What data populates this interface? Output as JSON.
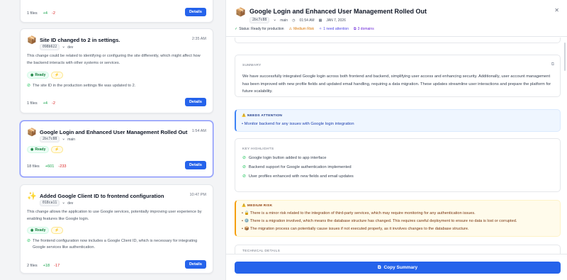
{
  "feed": {
    "cards": [
      {
        "id": "card0",
        "files": "1 files",
        "added": "+4",
        "removed": "-2",
        "details_label": "Details"
      },
      {
        "id": "card1",
        "emoji": "📦",
        "title": "Site ID changed to 2 in settings.",
        "time": "2:35 AM",
        "hash": "098b622",
        "author": "dev",
        "description": "This change could be related to identifying or configuring the site differently, which might affect how the backend interacts with other systems or services.",
        "status": "Ready",
        "risk_icon": "⚡",
        "checks": [
          "The site ID in the production settings file was updated to 2."
        ],
        "files": "1 files",
        "added": "+4",
        "removed": "-2",
        "details_label": "Details"
      },
      {
        "id": "card2",
        "emoji": "📦",
        "title": "Google Login and Enhanced User Management Rolled Out",
        "time": "1:54 AM",
        "hash": "2bc7c88",
        "author": "main",
        "status": "Ready",
        "risk_icon": "⚡",
        "files": "18 files",
        "added": "+601",
        "removed": "-233",
        "details_label": "Details"
      },
      {
        "id": "card3",
        "emoji": "✨",
        "title": "Added Google Client ID to frontend configuration",
        "time": "10:47 PM",
        "hash": "018ca11",
        "author": "dev",
        "description": "This change allows the application to use Google services, potentially improving user experience by enabling features like Google login.",
        "status": "Ready",
        "risk_icon": "⚡",
        "checks": [
          "The frontend configuration now includes a Google Client ID, which is necessary for integrating Google services like authentication."
        ],
        "files": "2 files",
        "added": "+18",
        "removed": "-17",
        "details_label": "Details"
      }
    ]
  },
  "panel": {
    "emoji": "📦",
    "title": "Google Login and Enhanced User Management Rolled Out",
    "hash": "2bc7c88",
    "branch": "main",
    "time": "01:54 AM",
    "date": "JAN 7, 2026",
    "status_chips": [
      {
        "icon": "✓",
        "text": "Status: Ready for production",
        "color": "#374151",
        "icon_color": "#16a34a"
      },
      {
        "icon": "⚠",
        "text": "Medium Risk",
        "color": "#d97706",
        "icon_color": "#d97706"
      },
      {
        "icon": "✧",
        "text": "1 need attention",
        "color": "#4f46e5",
        "icon_color": "#4f46e5"
      },
      {
        "icon": "⧉",
        "text": "3 domains",
        "color": "#6d28d9",
        "icon_color": "#6d28d9"
      }
    ],
    "summary": {
      "label": "SUMMARY",
      "text": "We have successfully integrated Google login across both frontend and backend, simplifying user access and enhancing security. Additionally, user account management has been improved with new profile fields and updated email handling, requiring a data migration. These updates streamline user interactions and prepare the platform for future scalability."
    },
    "attention": {
      "label": "⚠️ NEEDS ATTENTION",
      "items": [
        "Monitor backend for any issues with Google login integration"
      ]
    },
    "highlights": {
      "label": "KEY HIGHLIGHTS",
      "items": [
        "Google login button added to app interface",
        "Backend support for Google authentication implemented",
        "User profiles enhanced with new fields and email updates"
      ]
    },
    "risk": {
      "label": "⚠️ MEDIUM RISK",
      "items": [
        "• 🔒 There is a minor risk related to the integration of third-party services, which may require monitoring for any authentication issues.",
        "• ⚙️ There is a migration involved, which means the database structure has changed. This requires careful deployment to ensure no data is lost or corrupted.",
        "• 📦 The migration process can potentially cause issues if not executed properly, as it involves changes to the database structure."
      ]
    },
    "next_label": "TECHNICAL DETAILS",
    "copy_button": "Copy Summary"
  }
}
